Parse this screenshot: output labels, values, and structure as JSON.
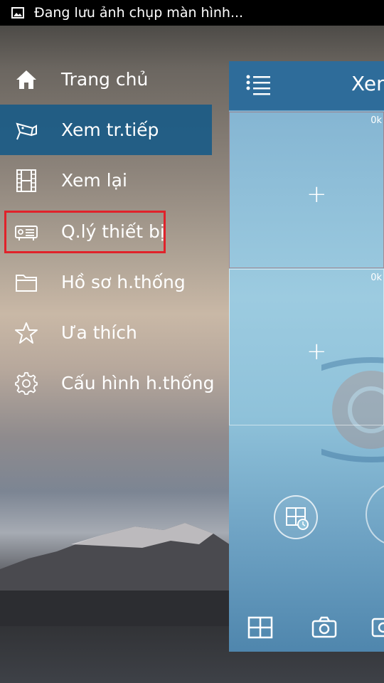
{
  "status_bar": {
    "notification": "Đang lưu ảnh chụp màn hình..."
  },
  "menu": {
    "items": [
      {
        "label": "Trang chủ",
        "icon": "home-icon"
      },
      {
        "label": "Xem tr.tiếp",
        "icon": "live-camera-icon",
        "active": true
      },
      {
        "label": "Xem lại",
        "icon": "film-strip-icon"
      },
      {
        "label": "Q.lý thiết bị",
        "icon": "device-manager-icon",
        "highlighted": true
      },
      {
        "label": "Hồ sơ h.thống",
        "icon": "folder-icon"
      },
      {
        "label": "Ưa thích",
        "icon": "star-icon"
      },
      {
        "label": "Cấu hình h.thống",
        "icon": "settings-gear-icon"
      }
    ]
  },
  "panel": {
    "title": "Xem",
    "cells": [
      {
        "bitrate": "0k",
        "add_symbol": "+"
      },
      {
        "bitrate": "0k",
        "add_symbol": "+"
      }
    ]
  },
  "colors": {
    "active_item_bg": "#165a87",
    "highlight_border": "#e0222a",
    "panel_header_bg": "#2e6c9a"
  }
}
